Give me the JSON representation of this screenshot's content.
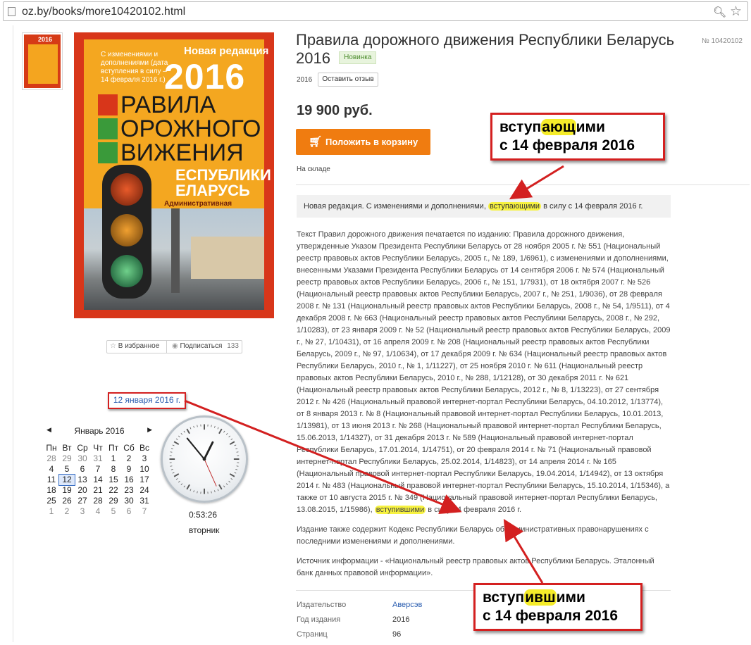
{
  "browser": {
    "url": "oz.by/books/more10420102.html"
  },
  "product": {
    "title": "Правила дорожного движения Республики Беларусь 2016",
    "badge": "Новинка",
    "number": "№ 10420102",
    "year": "2016",
    "review_button": "Оставить отзыв",
    "price": "19 900 руб.",
    "cart_button": "Положить в корзину",
    "stock": "На складе",
    "favorites": "В избранное",
    "subscribe": "Подписаться",
    "subscribe_count": "133",
    "summary": {
      "before": "Новая редакция. С изменениями и дополнениями, ",
      "highlight": "вступающими",
      "after": " в силу с 14 февраля 2016 г."
    },
    "description": {
      "main_before": "Текст Правил дорожного движения печатается по изданию: Правила дорожного движения, утвержденные Указом Президента Республики Беларусь от 28 ноября 2005 г. № 551 (Национальный реестр правовых актов Республики Беларусь, 2005 г., № 189, 1/6961), с изменениями и дополнениями, внесенными Указами Президента Республики Беларусь от 14 сентября 2006 г. № 574 (Национальный реестр правовых актов Республики Беларусь, 2006 г., № 151, 1/7931), от 18 октября 2007 г. № 526 (Национальный реестр правовых актов Республики Беларусь, 2007 г., № 251, 1/9036), от 28 февраля 2008 г. № 131 (Национальный реестр правовых актов Республики Беларусь, 2008 г., № 54, 1/9511), от 4 декабря 2008 г. № 663 (Национальный реестр правовых актов Республики Беларусь, 2008 г., № 292, 1/10283), от 23 января 2009 г. № 52 (Национальный реестр правовых актов Республики Беларусь, 2009 г., № 27, 1/10431), от 16 апреля 2009 г. № 208 (Национальный реестр правовых актов Республики Беларусь, 2009 г., № 97, 1/10634), от 17 декабря 2009 г. № 634 (Национальный реестр правовых актов Республики Беларусь, 2010 г., № 1, 1/11227), от 25 ноября 2010 г. № 611 (Национальный реестр правовых актов Республики Беларусь, 2010 г., № 288, 1/12128), от 30 декабря 2011 г. № 621 (Национальный реестр правовых актов Республики Беларусь, 2012 г., № 8, 1/13223), от 27 сентября 2012 г. № 426 (Национальный правовой интернет-портал Республики Беларусь, 04.10.2012, 1/13774), от 8 января 2013 г. № 8 (Национальный правовой интернет-портал Республики Беларусь, 10.01.2013, 1/13981), от 13 июня 2013 г. № 268 (Национальный правовой интернет-портал Республики Беларусь, 15.06.2013, 1/14327), от 31 декабря 2013 г. № 589 (Национальный правовой интернет-портал Республики Беларусь, 17.01.2014, 1/14751), от 20 февраля 2014 г. № 71 (Национальный правовой интернет-портал Республики Беларусь, 25.02.2014, 1/14823), от 14 апреля 2014 г. № 165 (Национальный правовой интернет-портал Республики Беларусь, 19.04.2014, 1/14942), от 13 октября 2014 г. № 483 (Национальный правовой интернет-портал Республики Беларусь, 15.10.2014, 1/15346), а также от 10 августа 2015 г. № 349 (Национальный правовой интернет-портал Республики Беларусь, 13.08.2015, 1/15986), ",
      "main_highlight": "вступившими",
      "main_after": " в силу 14 февраля 2016 г.",
      "para2": "Издание также содержит Кодекс Республики Беларусь об административных правонарушениях с последними изменениями и дополнениями.",
      "para3": "Источник информации - «Национальный реестр правовых актов Республики Беларусь. Эталонный банк данных правовой информации»."
    },
    "specs": [
      {
        "key": "Издательство",
        "value": "Аверсэв"
      },
      {
        "key": "Год издания",
        "value": "2016"
      },
      {
        "key": "Страниц",
        "value": "96"
      }
    ],
    "cover": {
      "new_edition": "Новая редакция",
      "year": "2016",
      "subtitle": "С изменениями и дополнениями (дата вступления в силу – 14 февраля 2016 г.)",
      "line1": "РАВИЛА",
      "line2": "ОРОЖНОГО",
      "line3": "ВИЖЕНИЯ",
      "line4": "ЕСПУБЛИКИ",
      "line5": "ЕЛАРУСЬ",
      "admin": "Административная ответственность за правонарушения в области дорожного движения"
    }
  },
  "widget": {
    "date_label": "12 января 2016 г.",
    "calendar": {
      "month": "Январь 2016",
      "weekdays": [
        "Пн",
        "Вт",
        "Ср",
        "Чт",
        "Пт",
        "Сб",
        "Вс"
      ],
      "weeks": [
        [
          "28",
          "29",
          "30",
          "31",
          "1",
          "2",
          "3"
        ],
        [
          "4",
          "5",
          "6",
          "7",
          "8",
          "9",
          "10"
        ],
        [
          "11",
          "12",
          "13",
          "14",
          "15",
          "16",
          "17"
        ],
        [
          "18",
          "19",
          "20",
          "21",
          "22",
          "23",
          "24"
        ],
        [
          "25",
          "26",
          "27",
          "28",
          "29",
          "30",
          "31"
        ],
        [
          "1",
          "2",
          "3",
          "4",
          "5",
          "6",
          "7"
        ]
      ],
      "today": "12"
    },
    "clock_time": "0:53:26",
    "clock_day": "вторник",
    "clock": {
      "hour": 0,
      "minute": 53,
      "second": 26
    }
  },
  "callouts": {
    "top": {
      "line1_pre": "вступ",
      "line1_hl": "ающ",
      "line1_post": "ими",
      "line2": "с 14 февраля 2016"
    },
    "bottom": {
      "line1_pre": "вступ",
      "line1_hl": "ивш",
      "line1_post": "ими",
      "line2": "с 14 февраля 2016"
    }
  },
  "colors": {
    "accent": "#f07c10",
    "annotation": "#d32020",
    "highlight": "#f7f240",
    "link": "#2a5db0"
  }
}
